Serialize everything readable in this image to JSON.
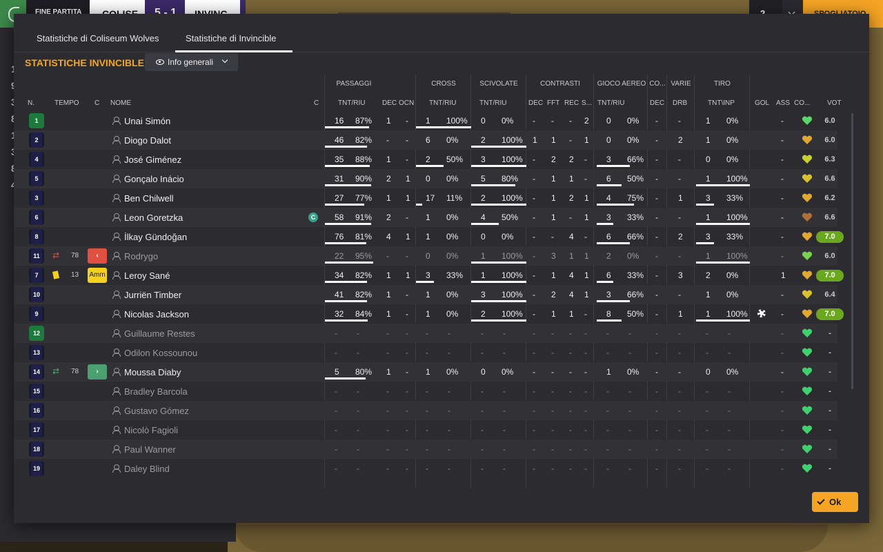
{
  "topbar": {
    "end_label": "FINE PARTITA",
    "home_team": "COLISE",
    "score": "5 - 1",
    "away_team": "INVINC",
    "right_count": "2",
    "right_action": "SPOGLIATOIO"
  },
  "tabs": [
    {
      "label": "Statistiche di Coliseum Wolves"
    },
    {
      "label": "Statistiche di Invincible",
      "active": true
    }
  ],
  "section_title": "STATISTICHE INVINCIBLE",
  "view_select": {
    "label": "Info generali",
    "icon": "eye-icon"
  },
  "column_groups": [
    "PASSAGGI",
    "CROSS",
    "SCIVOLATE",
    "CONTRASTI",
    "GIOCO AEREO",
    "CO...",
    "VARIE",
    "TIRO"
  ],
  "columns": [
    "N.",
    "TEMPO",
    "C",
    "NOME",
    "C",
    "TNT/RIU",
    "DEC",
    "OCN",
    "TNT/RIU",
    "TNT/RIU",
    "DEC",
    "FFT",
    "REC",
    "S...",
    "TNT/RIU",
    "DEC",
    "DRB",
    "TNT\\INP",
    "GOL",
    "ASS",
    "CO...",
    "VOT"
  ],
  "left_numbers": [
    "1",
    "9",
    "3",
    "8",
    "1",
    "3",
    "8",
    "4"
  ],
  "players": [
    {
      "n": "1",
      "gk": true,
      "name": "Unai Simón",
      "p_t": "16",
      "p_pct": "87%",
      "p_f": 0.87,
      "dec": "1",
      "ocn": "-",
      "c_t": "1",
      "c_pct": "100%",
      "c_f": 1,
      "s_t": "0",
      "s_pct": "0%",
      "s_f": 0,
      "cdec": "-",
      "fft": "-",
      "rec": "-",
      "s": "2",
      "a_t": "0",
      "a_pct": "0%",
      "a_f": 0,
      "codec": "-",
      "drb": "-",
      "t_t": "1",
      "t_pct": "0%",
      "t_f": 0,
      "gol": "",
      "ass": "-",
      "heart": "#5bd66a",
      "vot": "6.0",
      "vot_hi": false
    },
    {
      "n": "2",
      "name": "Diogo Dalot",
      "p_t": "46",
      "p_pct": "82%",
      "p_f": 0.82,
      "dec": "-",
      "ocn": "-",
      "c_t": "6",
      "c_pct": "0%",
      "c_f": 0,
      "s_t": "2",
      "s_pct": "100%",
      "s_f": 1,
      "cdec": "1",
      "fft": "1",
      "rec": "-",
      "s": "1",
      "a_t": "0",
      "a_pct": "0%",
      "a_f": 0,
      "codec": "-",
      "drb": "2",
      "t_t": "1",
      "t_pct": "0%",
      "t_f": 0,
      "gol": "",
      "ass": "-",
      "heart": "#e0a830",
      "vot": "6.0",
      "vot_hi": false
    },
    {
      "n": "4",
      "name": "José Giménez",
      "p_t": "35",
      "p_pct": "88%",
      "p_f": 0.88,
      "dec": "1",
      "ocn": "-",
      "c_t": "2",
      "c_pct": "50%",
      "c_f": 0.5,
      "s_t": "3",
      "s_pct": "100%",
      "s_f": 1,
      "cdec": "-",
      "fft": "2",
      "rec": "2",
      "s": "-",
      "a_t": "3",
      "a_pct": "66%",
      "a_f": 0.66,
      "codec": "-",
      "drb": "-",
      "t_t": "0",
      "t_pct": "0%",
      "t_f": 0,
      "gol": "",
      "ass": "-",
      "heart": "#c8d030",
      "vot": "6.3",
      "vot_hi": false
    },
    {
      "n": "5",
      "name": "Gonçalo Inácio",
      "p_t": "31",
      "p_pct": "90%",
      "p_f": 0.9,
      "dec": "2",
      "ocn": "1",
      "c_t": "0",
      "c_pct": "0%",
      "c_f": 0,
      "s_t": "5",
      "s_pct": "80%",
      "s_f": 0.8,
      "cdec": "-",
      "fft": "1",
      "rec": "1",
      "s": "-",
      "a_t": "6",
      "a_pct": "50%",
      "a_f": 0.5,
      "codec": "-",
      "drb": "-",
      "t_t": "1",
      "t_pct": "100%",
      "t_f": 1,
      "gol": "",
      "ass": "-",
      "heart": "#d8c030",
      "vot": "6.6",
      "vot_hi": false
    },
    {
      "n": "3",
      "name": "Ben Chilwell",
      "p_t": "27",
      "p_pct": "77%",
      "p_f": 0.77,
      "dec": "1",
      "ocn": "1",
      "c_t": "17",
      "c_pct": "11%",
      "c_f": 0.11,
      "s_t": "2",
      "s_pct": "100%",
      "s_f": 1,
      "cdec": "-",
      "fft": "1",
      "rec": "2",
      "s": "1",
      "a_t": "4",
      "a_pct": "75%",
      "a_f": 0.75,
      "codec": "-",
      "drb": "1",
      "t_t": "3",
      "t_pct": "33%",
      "t_f": 0.33,
      "gol": "",
      "ass": "-",
      "heart": "#e0a830",
      "vot": "6.2",
      "vot_hi": false
    },
    {
      "n": "6",
      "name": "Leon Goretzka",
      "captain": true,
      "p_t": "58",
      "p_pct": "91%",
      "p_f": 0.91,
      "dec": "2",
      "ocn": "-",
      "c_t": "1",
      "c_pct": "0%",
      "c_f": 0,
      "s_t": "4",
      "s_pct": "50%",
      "s_f": 0.5,
      "cdec": "-",
      "fft": "1",
      "rec": "-",
      "s": "1",
      "a_t": "3",
      "a_pct": "33%",
      "a_f": 0.33,
      "codec": "-",
      "drb": "-",
      "t_t": "1",
      "t_pct": "100%",
      "t_f": 1,
      "gol": "",
      "ass": "-",
      "heart": "#b0703a",
      "vot": "6.6",
      "vot_hi": false
    },
    {
      "n": "8",
      "name": "İlkay Gündoğan",
      "p_t": "76",
      "p_pct": "81%",
      "p_f": 0.81,
      "dec": "4",
      "ocn": "1",
      "c_t": "1",
      "c_pct": "0%",
      "c_f": 0,
      "s_t": "0",
      "s_pct": "0%",
      "s_f": 0,
      "cdec": "-",
      "fft": "-",
      "rec": "4",
      "s": "-",
      "a_t": "6",
      "a_pct": "66%",
      "a_f": 0.66,
      "codec": "-",
      "drb": "2",
      "t_t": "3",
      "t_pct": "33%",
      "t_f": 0.33,
      "gol": "",
      "ass": "-",
      "heart": "#e0a830",
      "vot": "7.0",
      "vot_hi": true
    },
    {
      "n": "11",
      "name": "Rodrygo",
      "sub_out": true,
      "tempo": "78",
      "badge": "out",
      "dim": true,
      "p_t": "22",
      "p_pct": "95%",
      "p_f": 0.95,
      "dec": "-",
      "ocn": "-",
      "c_t": "0",
      "c_pct": "0%",
      "c_f": 0,
      "s_t": "1",
      "s_pct": "100%",
      "s_f": 1,
      "cdec": "-",
      "fft": "3",
      "rec": "1",
      "s": "1",
      "a_t": "2",
      "a_pct": "0%",
      "a_f": 0,
      "codec": "-",
      "drb": "-",
      "t_t": "1",
      "t_pct": "100%",
      "t_f": 1,
      "gol": "",
      "ass": "-",
      "heart": "#7ad050",
      "vot": "6.0",
      "vot_hi": false
    },
    {
      "n": "7",
      "name": "Leroy Sané",
      "yellow": true,
      "tempo": "13",
      "badge": "amm",
      "badge_label": "Amm",
      "p_t": "34",
      "p_pct": "82%",
      "p_f": 0.82,
      "dec": "1",
      "ocn": "1",
      "c_t": "3",
      "c_pct": "33%",
      "c_f": 0.33,
      "s_t": "1",
      "s_pct": "100%",
      "s_f": 1,
      "cdec": "-",
      "fft": "1",
      "rec": "4",
      "s": "1",
      "a_t": "6",
      "a_pct": "33%",
      "a_f": 0.33,
      "codec": "-",
      "drb": "3",
      "t_t": "2",
      "t_pct": "0%",
      "t_f": 0,
      "gol": "",
      "ass": "1",
      "heart": "#e0a830",
      "vot": "7.0",
      "vot_hi": true
    },
    {
      "n": "10",
      "name": "Jurriën Timber",
      "p_t": "41",
      "p_pct": "82%",
      "p_f": 0.82,
      "dec": "1",
      "ocn": "-",
      "c_t": "1",
      "c_pct": "0%",
      "c_f": 0,
      "s_t": "3",
      "s_pct": "100%",
      "s_f": 1,
      "cdec": "-",
      "fft": "2",
      "rec": "4",
      "s": "1",
      "a_t": "3",
      "a_pct": "66%",
      "a_f": 0.66,
      "codec": "-",
      "drb": "-",
      "t_t": "1",
      "t_pct": "0%",
      "t_f": 0,
      "gol": "",
      "ass": "-",
      "heart": "#d8c030",
      "vot": "6.4",
      "vot_hi": false
    },
    {
      "n": "9",
      "name": "Nicolas Jackson",
      "p_t": "32",
      "p_pct": "84%",
      "p_f": 0.84,
      "dec": "1",
      "ocn": "-",
      "c_t": "1",
      "c_pct": "0%",
      "c_f": 0,
      "s_t": "2",
      "s_pct": "100%",
      "s_f": 1,
      "cdec": "-",
      "fft": "1",
      "rec": "1",
      "s": "-",
      "a_t": "8",
      "a_pct": "50%",
      "a_f": 0.5,
      "codec": "-",
      "drb": "1",
      "t_t": "1",
      "t_pct": "100%",
      "t_f": 1,
      "gol": "ball",
      "ass": "-",
      "heart": "#e0a830",
      "vot": "7.0",
      "vot_hi": true
    },
    {
      "n": "12",
      "gk": true,
      "name": "Guillaume Restes",
      "dim": true,
      "empty": true,
      "heart": "#40d070",
      "vot": "-"
    },
    {
      "n": "13",
      "name": "Odilon Kossounou",
      "dim": true,
      "empty": true,
      "heart": "#40d070",
      "vot": "-"
    },
    {
      "n": "14",
      "name": "Moussa Diaby",
      "sub_in": true,
      "tempo": "78",
      "badge": "in",
      "p_t": "5",
      "p_pct": "80%",
      "p_f": 0.8,
      "dec": "1",
      "ocn": "-",
      "c_t": "1",
      "c_pct": "0%",
      "c_f": 0,
      "s_t": "0",
      "s_pct": "0%",
      "s_f": 0,
      "cdec": "-",
      "fft": "-",
      "rec": "-",
      "s": "-",
      "a_t": "1",
      "a_pct": "0%",
      "a_f": 0,
      "codec": "-",
      "drb": "-",
      "t_t": "0",
      "t_pct": "0%",
      "t_f": 0,
      "gol": "",
      "ass": "-",
      "heart": "#40d070",
      "vot": "-",
      "vot_hi": false
    },
    {
      "n": "15",
      "name": "Bradley Barcola",
      "dim": true,
      "empty": true,
      "heart": "#40d070",
      "vot": "-"
    },
    {
      "n": "16",
      "name": "Gustavo Gómez",
      "dim": true,
      "empty": true,
      "heart": "#40d070",
      "vot": "-"
    },
    {
      "n": "17",
      "name": "Nicolò Fagioli",
      "dim": true,
      "empty": true,
      "heart": "#40d070",
      "vot": "-"
    },
    {
      "n": "18",
      "name": "Paul Wanner",
      "dim": true,
      "empty": true,
      "heart": "#40d070",
      "vot": "-"
    },
    {
      "n": "19",
      "name": "Daley Blind",
      "dim": true,
      "empty": true,
      "heart": "#40d070",
      "vot": "-"
    }
  ],
  "ok_label": "Ok",
  "colors": {
    "accent": "#f5a524",
    "vote_high": "#6aa820",
    "out_red": "#e05040",
    "in_green": "#4aa070",
    "yellow": "#f5d020"
  }
}
